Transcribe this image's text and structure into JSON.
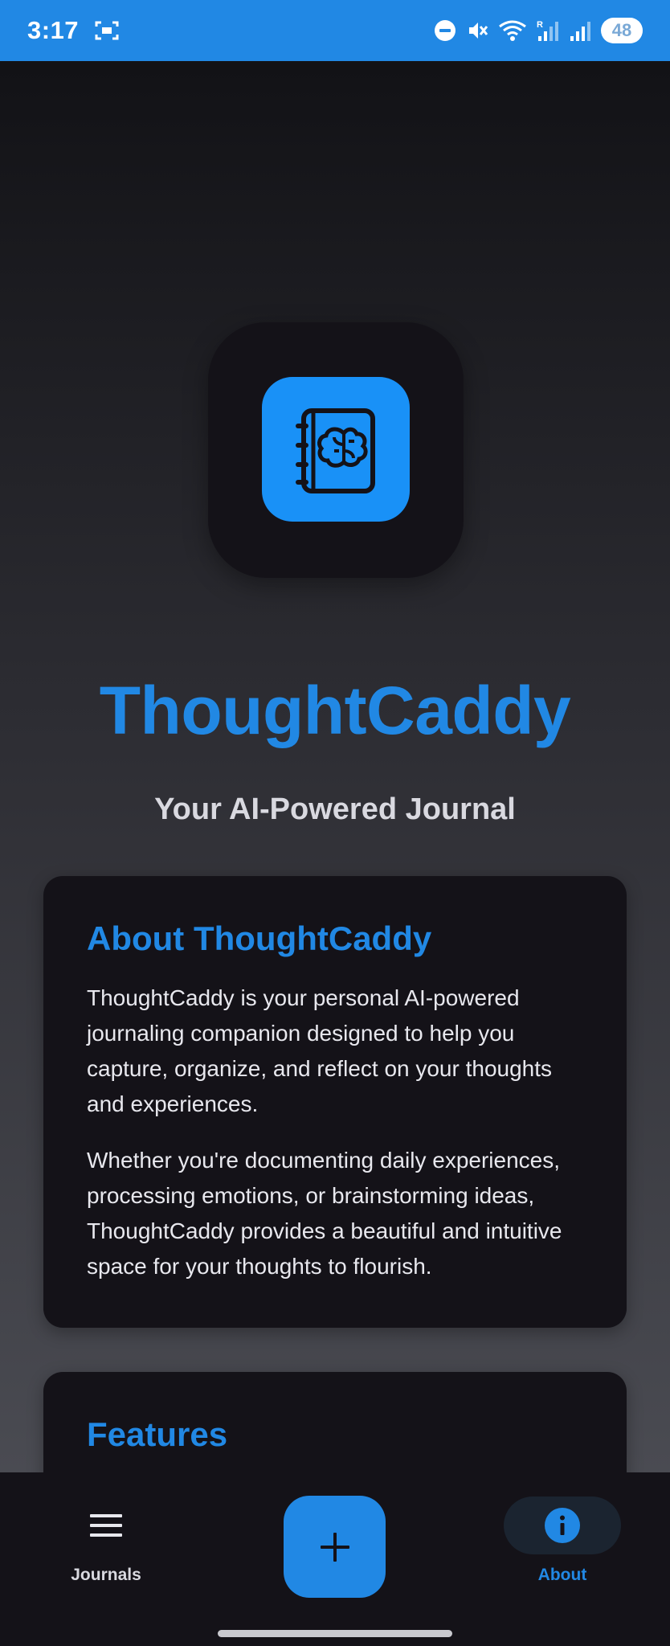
{
  "status_bar": {
    "time": "3:17",
    "battery": "48",
    "icons": [
      "screen-record-icon",
      "dnd-icon",
      "mute-icon",
      "wifi-icon",
      "signal-r-icon",
      "signal-icon",
      "battery-icon"
    ]
  },
  "app": {
    "logo_icon": "brain-notebook-icon",
    "title": "ThoughtCaddy",
    "subtitle": "Your AI-Powered Journal"
  },
  "about": {
    "title": "About ThoughtCaddy",
    "paragraphs": [
      "ThoughtCaddy is your personal AI-powered journaling companion designed to help you capture, organize, and reflect on your thoughts and experiences.",
      "Whether you're documenting daily experiences, processing emotions, or brainstorming ideas, ThoughtCaddy provides a beautiful and intuitive space for your thoughts to flourish."
    ]
  },
  "features": {
    "title": "Features"
  },
  "bottom_nav": {
    "journals_label": "Journals",
    "journals_icon": "menu-icon",
    "add_icon": "plus-icon",
    "about_label": "About",
    "about_icon": "info-icon",
    "active": "About"
  },
  "colors": {
    "accent": "#2188e4",
    "status_bar": "#2188e4",
    "card_bg": "#141218",
    "logo_bg": "#1991f7"
  }
}
